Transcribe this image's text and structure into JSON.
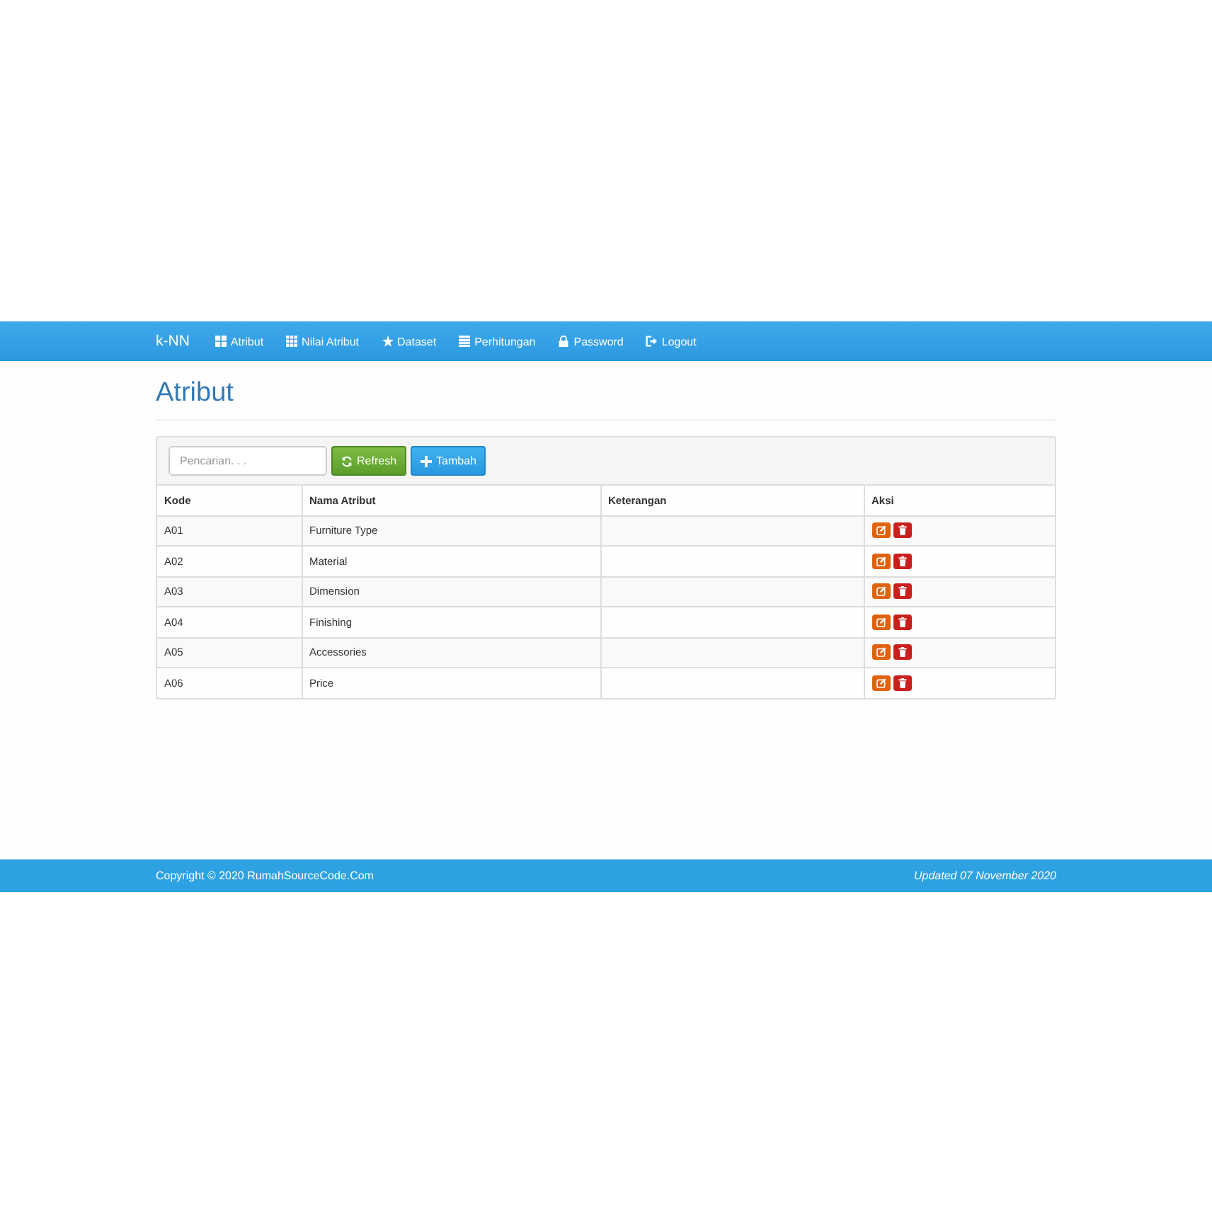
{
  "navbar": {
    "brand": "k-NN",
    "items": [
      {
        "label": "Atribut",
        "kind": "grid"
      },
      {
        "label": "Nilai Atribut",
        "kind": "grid9"
      },
      {
        "label": "Dataset",
        "kind": "star"
      },
      {
        "label": "Perhitungan",
        "kind": "calc"
      },
      {
        "label": "Password",
        "kind": "lock"
      },
      {
        "label": "Logout",
        "kind": "logout"
      }
    ]
  },
  "page_title": "Atribut",
  "toolbar": {
    "search": {
      "placeholder": "Pencarian. . ."
    },
    "buttons": [
      {
        "label": "Refresh",
        "kind": "refresh"
      },
      {
        "label": "Tambah",
        "kind": "add"
      }
    ]
  },
  "table": {
    "columns": [
      "Kode",
      "Nama Atribut",
      "Keterangan",
      "Aksi"
    ],
    "rows": [
      {
        "kode": "A01",
        "nama": "Furniture Type"
      },
      {
        "kode": "A02",
        "nama": "Material"
      },
      {
        "kode": "A03",
        "nama": "Dimension"
      },
      {
        "kode": "A04",
        "nama": "Finishing"
      },
      {
        "kode": "A05",
        "nama": "Accessories"
      },
      {
        "kode": "A06",
        "nama": "Price"
      }
    ]
  },
  "footer": {
    "copyright": "Copyright © 2020 RumahSourceCode.Com",
    "updated": "Updated 07 November 2020"
  }
}
